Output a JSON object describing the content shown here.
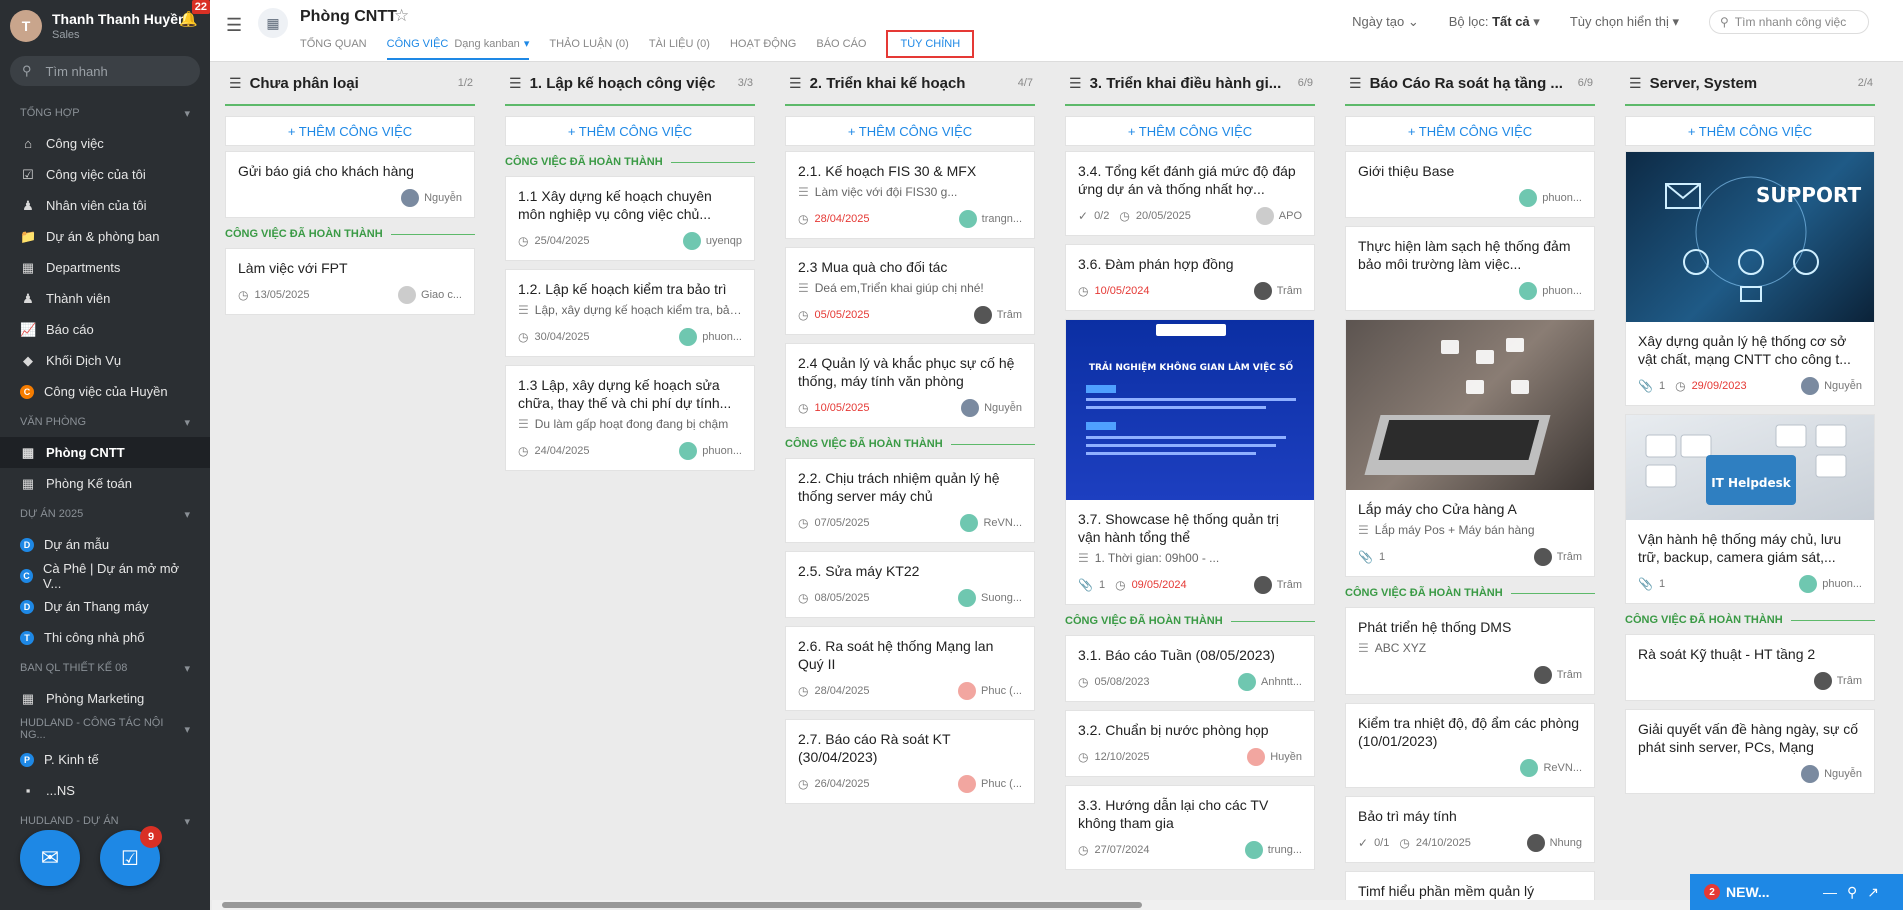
{
  "user": {
    "name": "Thanh Thanh Huyền",
    "role": "Sales",
    "notif_count": "22"
  },
  "sidebar": {
    "search_placeholder": "Tìm nhanh",
    "sections": [
      {
        "title": "TỔNG HỢP",
        "items": [
          "Công việc",
          "Công việc của tôi",
          "Nhân viên của tôi",
          "Dự án & phòng ban",
          "Departments",
          "Thành viên",
          "Báo cáo",
          "Khối Dịch Vụ",
          "Công việc của Huyền"
        ]
      },
      {
        "title": "VĂN PHÒNG",
        "items": [
          "Phòng CNTT",
          "Phòng Kế toán"
        ]
      },
      {
        "title": "DỰ ÁN 2025",
        "items": [
          "Dự án mẫu",
          "Cà Phê | Dự án mở mở V...",
          "Dự án Thang máy",
          "Thi công nhà phố"
        ]
      },
      {
        "title": "BAN QL THIẾT KẾ 08",
        "items": [
          "Phòng Marketing"
        ]
      },
      {
        "title": "HUDLAND - CÔNG TÁC NỘI NG...",
        "items": [
          "P. Kinh tế",
          "...NS"
        ]
      },
      {
        "title": "HUDLAND - DỰ ÁN",
        "items": []
      }
    ],
    "task_badge": "9"
  },
  "header": {
    "title": "Phòng CNTT",
    "tabs": [
      "TỔNG QUAN",
      "CÔNG VIỆC",
      "THẢO LUẬN (0)",
      "TÀI LIỆU (0)",
      "HOẠT ĐỘNG",
      "BÁO CÁO",
      "TÙY CHỈNH"
    ],
    "tab_sub": "Dạng kanban",
    "sort": "Ngày tạo",
    "filter_label": "Bộ lọc:",
    "filter_value": "Tất cả",
    "display": "Tùy chọn hiển thị",
    "search_placeholder": "Tìm nhanh công việc"
  },
  "add_label": "+ THÊM CÔNG VIỆC",
  "done_label": "CÔNG VIỆC ĐÃ HOÀN THÀNH",
  "columns": [
    {
      "title": "Chưa phân loại",
      "count": "1/2",
      "cards": [
        {
          "title": "Gửi báo giá cho khách hàng",
          "user": "Nguyễn"
        }
      ],
      "done": [
        {
          "title": "Làm việc với FPT",
          "date": "13/05/2025",
          "user": "Giao c..."
        }
      ]
    },
    {
      "title": "1. Lập kế hoạch công việc",
      "count": "3/3",
      "cards": [],
      "done": [
        {
          "title": "1.1 Xây dựng kế hoạch chuyên môn nghiệp vụ công việc chủ...",
          "date": "25/04/2025",
          "user": "uyenqp"
        },
        {
          "title": "1.2. Lập kế hoạch kiểm tra bảo trì",
          "desc": "Lập, xây dựng kế hoạch kiểm tra, bảo ...",
          "date": "30/04/2025",
          "user": "phuon..."
        },
        {
          "title": "1.3 Lập, xây dựng kế hoạch sửa chữa, thay thế và chi phí dự tính...",
          "desc": "Du làm gấp hoạt đong đang bị chậm",
          "date": "24/04/2025",
          "user": "phuon..."
        }
      ]
    },
    {
      "title": "2. Triển khai kế hoạch",
      "count": "4/7",
      "cards": [
        {
          "title": "2.1. Kế hoạch FIS 30 & MFX",
          "desc": "Làm việc với đội FIS30 g...",
          "date": "28/04/2025",
          "user": "trangn..."
        },
        {
          "title": "2.3 Mua quà cho đối tác",
          "desc": "Deá em,Triển khai giúp chị nhé!",
          "date": "05/05/2025",
          "user": "Trâm"
        },
        {
          "title": "2.4 Quản lý và khắc phục sự cố hệ thống, máy tính văn phòng",
          "date": "10/05/2025",
          "user": "Nguyễn"
        }
      ],
      "done": [
        {
          "title": "2.2. Chịu trách nhiệm quản lý hệ thống server máy chủ",
          "date": "07/05/2025",
          "user": "ReVN..."
        },
        {
          "title": "2.5. Sửa máy KT22",
          "date": "08/05/2025",
          "user": "Suong..."
        },
        {
          "title": "2.6. Ra soát hệ thống Mạng lan Quý II",
          "date": "28/04/2025",
          "user": "Phuc (..."
        },
        {
          "title": "2.7. Báo cáo Rà soát KT (30/04/2023)",
          "date": "26/04/2025",
          "user": "Phuc (..."
        }
      ]
    },
    {
      "title": "3. Triển khai điều hành gi...",
      "count": "6/9",
      "cards": [
        {
          "title": "3.4. Tổng kết đánh giá mức độ đáp ứng dự án và thống nhất hợ...",
          "check": "0/2",
          "date": "20/05/2025",
          "user": "APO"
        },
        {
          "title": "3.6. Đàm phán hợp đồng",
          "date": "10/05/2024",
          "user": "Trâm"
        },
        {
          "title": "3.7. Showcase hệ thống quản trị vận hành tổng thể",
          "desc": "1. Thời gian: 09h00 - ...",
          "attach": "1",
          "date": "09/05/2024",
          "user": "Trâm",
          "image": "TRẢI NGHIỆM KHÔNG GIAN LÀM VIỆC SỐ"
        }
      ],
      "done": [
        {
          "title": "3.1. Báo cáo Tuần (08/05/2023)",
          "date": "05/08/2023",
          "user": "Anhntt..."
        },
        {
          "title": "3.2. Chuẩn bị nước phòng họp",
          "date": "12/10/2025",
          "user": "Huyền"
        },
        {
          "title": "3.3. Hướng dẫn lại cho các TV không tham gia",
          "date": "27/07/2024",
          "user": "trung..."
        }
      ]
    },
    {
      "title": "Báo Cáo Ra soát hạ tầng ...",
      "count": "6/9",
      "cards": [
        {
          "title": "Giới thiệu Base",
          "user": "phuon..."
        },
        {
          "title": "Thực hiện làm sạch hệ thống đảm bảo môi trường làm việc...",
          "user": "phuon..."
        },
        {
          "title": "Lắp máy cho Cửa hàng A",
          "desc": "Lắp máy Pos + Máy bán hàng",
          "attach": "1",
          "user": "Trâm",
          "image": "laptop"
        }
      ],
      "done": [
        {
          "title": "Phát triển hệ thống DMS",
          "desc": "ABC XYZ",
          "user": "Trâm"
        },
        {
          "title": "Kiểm tra nhiệt độ, độ ẩm các phòng (10/01/2023)",
          "user": "ReVN..."
        },
        {
          "title": "Bảo trì máy tính",
          "check": "0/1",
          "date": "24/10/2025",
          "user": "Nhung"
        },
        {
          "title": "Timf hiểu phần mềm quản lý",
          "user": ""
        }
      ]
    },
    {
      "title": "Server, System",
      "count": "2/4",
      "cards": [
        {
          "title": "Xây dựng quản lý hệ thống cơ sở vật chất, mạng CNTT cho công t...",
          "attach": "1",
          "date": "29/09/2023",
          "user": "Nguyễn",
          "image": "SUPPORT"
        },
        {
          "title": "Vận hành hệ thống máy chủ, lưu trữ, backup, camera giám sát,...",
          "attach": "1",
          "user": "phuon...",
          "image": "IT Helpdesk"
        }
      ],
      "done": [
        {
          "title": "Rà soát Kỹ thuật - HT tầng 2",
          "user": "Trâm"
        },
        {
          "title": "Giải quyết vấn đề hàng ngày, sự cố phát sinh server, PCs, Mạng",
          "user": "Nguyễn"
        }
      ]
    }
  ],
  "newwin": {
    "badge": "2",
    "label": "NEW..."
  }
}
